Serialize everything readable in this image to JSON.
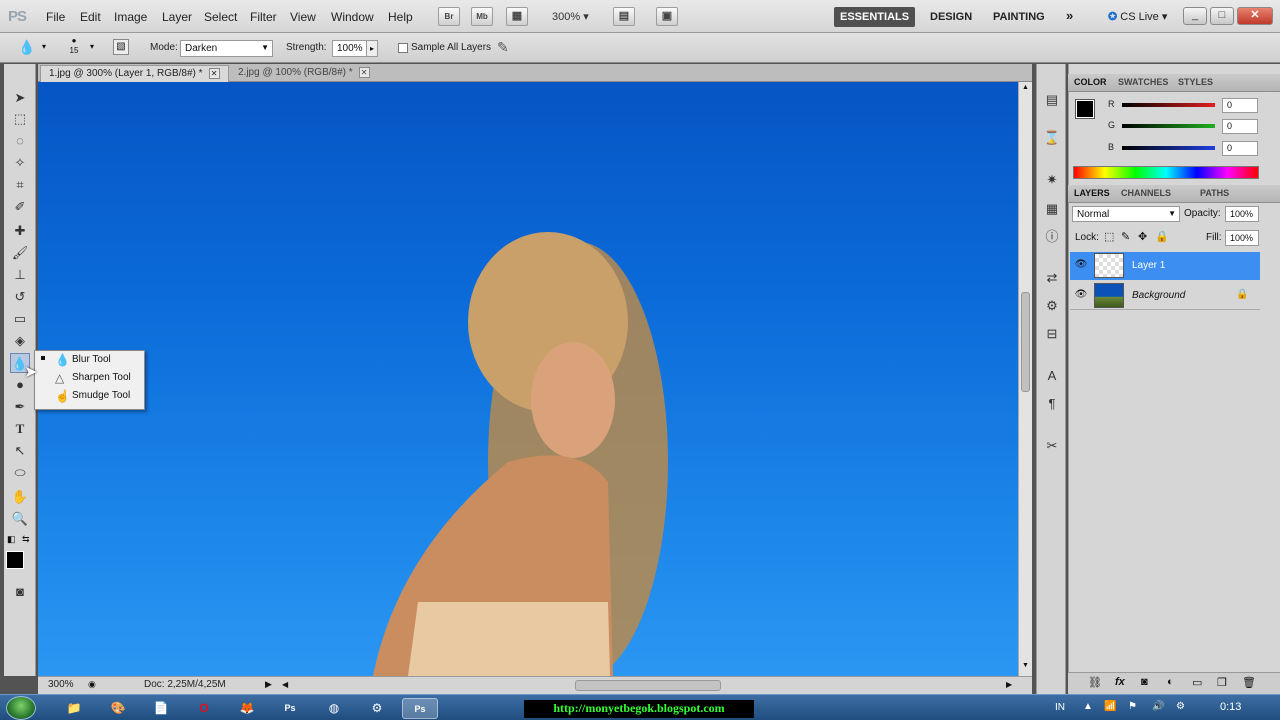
{
  "app": {
    "logo": "PS"
  },
  "menu": [
    "File",
    "Edit",
    "Image",
    "Layer",
    "Select",
    "Filter",
    "View",
    "Window",
    "Help"
  ],
  "appbar": {
    "bridge": "Br",
    "minibridge": "Mb",
    "zoom": "300%"
  },
  "workspaces": [
    "ESSENTIALS",
    "DESIGN",
    "PAINTING"
  ],
  "workspace_more": "»",
  "cslive": "CS Live",
  "window_controls": {
    "minimize": "_",
    "maximize": "□",
    "close": "✕"
  },
  "options": {
    "brush_size": "15",
    "mode_label": "Mode:",
    "mode_value": "Darken",
    "strength_label": "Strength:",
    "strength_value": "100%",
    "sample_all_layers": "Sample All Layers"
  },
  "tabs": [
    {
      "label": "1.jpg @ 300% (Layer 1, RGB/8#) *"
    },
    {
      "label": "2.jpg @ 100% (RGB/8#) *"
    }
  ],
  "flyout": [
    {
      "label": "Blur Tool",
      "icon": "blur-drop-icon"
    },
    {
      "label": "Sharpen Tool",
      "icon": "sharpen-triangle-icon"
    },
    {
      "label": "Smudge Tool",
      "icon": "smudge-finger-icon"
    }
  ],
  "status": {
    "zoom": "300%",
    "doc": "Doc: 2,25M/4,25M"
  },
  "color_panel": {
    "tabs": [
      "COLOR",
      "SWATCHES",
      "STYLES"
    ],
    "channels": [
      {
        "label": "R",
        "value": "0",
        "color": "#e02020"
      },
      {
        "label": "G",
        "value": "0",
        "color": "#20b020"
      },
      {
        "label": "B",
        "value": "0",
        "color": "#2040e0"
      }
    ]
  },
  "layers_panel": {
    "tabs": [
      "LAYERS",
      "CHANNELS",
      "PATHS"
    ],
    "blend_mode": "Normal",
    "opacity_label": "Opacity:",
    "opacity_value": "100%",
    "lock_label": "Lock:",
    "fill_label": "Fill:",
    "fill_value": "100%",
    "layers": [
      {
        "name": "Layer 1",
        "selected": true
      },
      {
        "name": "Background",
        "selected": false
      }
    ]
  },
  "taskbar": {
    "banner": "http://monyetbegok.blogspot.com",
    "lang": "IN",
    "clock": "0:13"
  }
}
